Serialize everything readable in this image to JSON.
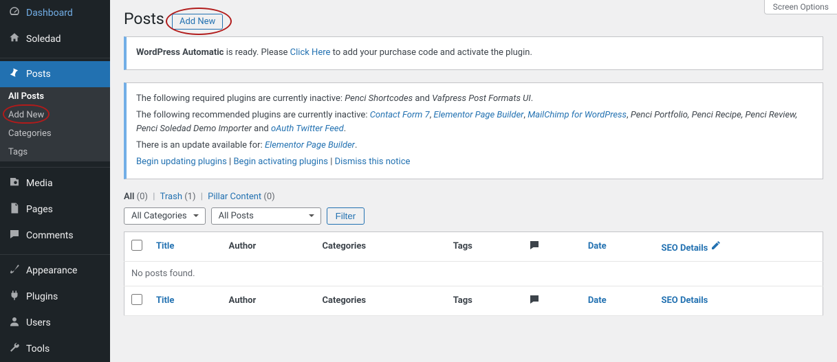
{
  "sidebar": {
    "items": [
      {
        "label": "Dashboard"
      },
      {
        "label": "Soledad"
      },
      {
        "label": "Posts"
      },
      {
        "label": "Media"
      },
      {
        "label": "Pages"
      },
      {
        "label": "Comments"
      },
      {
        "label": "Appearance"
      },
      {
        "label": "Plugins"
      },
      {
        "label": "Users"
      },
      {
        "label": "Tools"
      }
    ],
    "posts_submenu": [
      "All Posts",
      "Add New",
      "Categories",
      "Tags"
    ]
  },
  "screen_options_label": "Screen Options",
  "page_title": "Posts",
  "add_new_label": "Add New",
  "notice1": {
    "strong": "WordPress Automatic ",
    "text1": "is ready. Please ",
    "link": "Click Here",
    "text2": " to add your purchase code and activate the plugin."
  },
  "notice2": {
    "req_prefix": "The following required plugins are currently inactive: ",
    "req_em1": "Penci Shortcodes",
    "req_and": " and ",
    "req_em2": "Vafpress Post Formats UI",
    "rec_prefix": "The following recommended plugins are currently inactive: ",
    "rec_links": [
      "Contact Form 7",
      "Elementor Page Builder",
      "MailChimp for WordPress"
    ],
    "rec_tail_em": "Penci Portfolio, Penci Recipe, Penci Review, Penci Soledad Demo Importer",
    "rec_and": " and ",
    "rec_last_link": "oAuth Twitter Feed",
    "update_prefix": "There is an update available for: ",
    "update_link": "Elementor Page Builder",
    "action_begin_update": "Begin updating plugins",
    "action_begin_activate": "Begin activating plugins",
    "action_dismiss": "Dismiss this notice",
    "sep": " | "
  },
  "views": {
    "all_label": "All",
    "all_count": "(0)",
    "trash_label": "Trash",
    "trash_count": "(1)",
    "pillar_label": "Pillar Content",
    "pillar_count": "(0)",
    "sep": " | "
  },
  "filters": {
    "categories": "All Categories",
    "posts": "All Posts",
    "button": "Filter"
  },
  "table": {
    "cols": {
      "title": "Title",
      "author": "Author",
      "categories": "Categories",
      "tags": "Tags",
      "date": "Date",
      "seo": "SEO Details"
    },
    "empty": "No posts found."
  }
}
